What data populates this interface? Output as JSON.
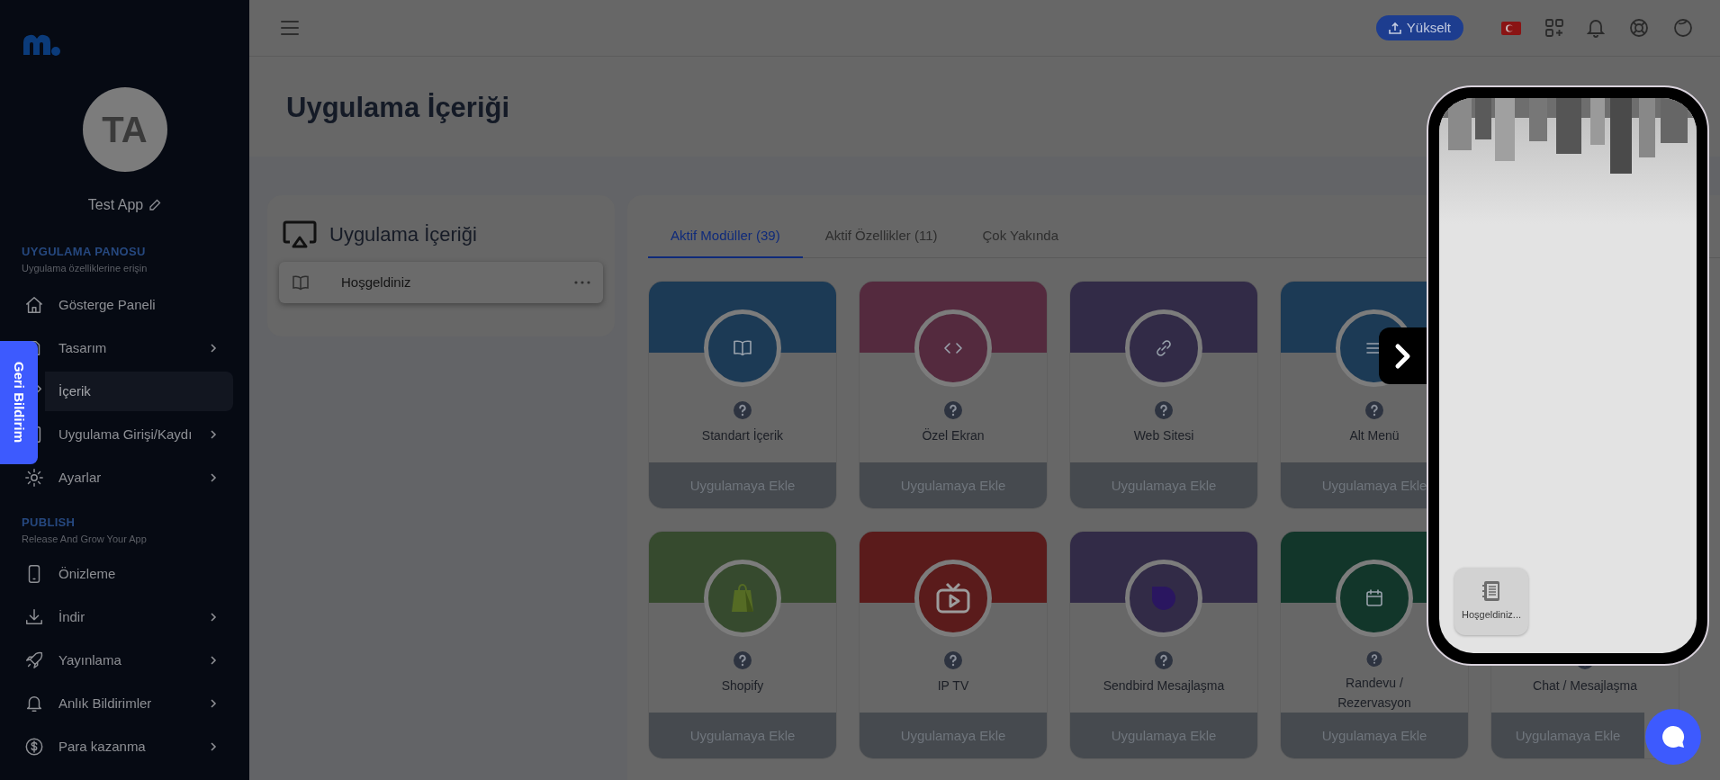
{
  "sidebar": {
    "avatar_initials": "TA",
    "app_name": "Test App",
    "sections": [
      {
        "title": "UYGULAMA PANOSU",
        "subtitle": "Uygulama özelliklerine erişin",
        "items": [
          {
            "label": "Gösterge Paneli",
            "has_submenu": false,
            "selected": false
          },
          {
            "label": "Tasarım",
            "has_submenu": true,
            "selected": false
          },
          {
            "label": "İçerik",
            "has_submenu": false,
            "selected": true
          },
          {
            "label": "Uygulama Girişi/Kaydı",
            "has_submenu": true,
            "selected": false
          },
          {
            "label": "Ayarlar",
            "has_submenu": true,
            "selected": false
          }
        ]
      },
      {
        "title": "PUBLISH",
        "subtitle": "Release And Grow Your App",
        "items": [
          {
            "label": "Önizleme",
            "has_submenu": false,
            "selected": false
          },
          {
            "label": "İndir",
            "has_submenu": true,
            "selected": false
          },
          {
            "label": "Yayınlama",
            "has_submenu": true,
            "selected": false
          },
          {
            "label": "Anlık Bildirimler",
            "has_submenu": true,
            "selected": false
          },
          {
            "label": "Para kazanma",
            "has_submenu": true,
            "selected": false
          }
        ]
      }
    ]
  },
  "feedback_tab": "Geri Bildirim",
  "header": {
    "upgrade_button": "Yükselt"
  },
  "page_title": "Uygulama İçeriği",
  "content_panel": {
    "title": "Uygulama İçeriği",
    "items": [
      {
        "label": "Hoşgeldiniz"
      }
    ]
  },
  "module_tabs": [
    {
      "label": "Aktif Modüller (39)",
      "selected": true
    },
    {
      "label": "Aktif Özellikler (11)",
      "selected": false
    },
    {
      "label": "Çok Yakında",
      "selected": false
    }
  ],
  "module_rows": [
    [
      {
        "name": "Standart İçerik",
        "color": "#1c3a55",
        "action": "Uygulamaya Ekle"
      },
      {
        "name": "Özel Ekran",
        "color": "#542a3e",
        "action": "Uygulamaya Ekle"
      },
      {
        "name": "Web Sitesi",
        "color": "#322b47",
        "action": "Uygulamaya Ekle"
      },
      {
        "name": "Alt Menü",
        "color": "#1c3a55",
        "action": "Uygulamaya Ekle"
      }
    ],
    [
      {
        "name": "Shopify",
        "color": "#364a2e",
        "action": "Uygulamaya Ekle"
      },
      {
        "name": "IP TV",
        "color": "#5a1b1b",
        "action": "Uygulamaya Ekle"
      },
      {
        "name": "Sendbird Mesajlaşma",
        "color": "#322b47",
        "action": "Uygulamaya Ekle"
      },
      {
        "name": "Randevu / Rezervasyon",
        "color": "#12362a",
        "action": "Uygulamaya Ekle"
      },
      {
        "name": "Chat / Mesajlaşma",
        "action": "Uygulamaya Ekle"
      }
    ]
  ],
  "preview": {
    "tiles": [
      {
        "label": "Hoşgeldiniz..."
      }
    ]
  }
}
